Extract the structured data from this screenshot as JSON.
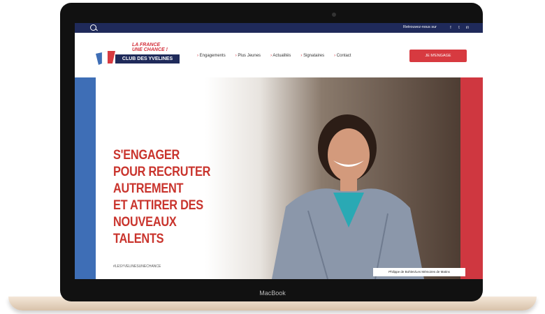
{
  "topbar": {
    "follow_text": "Retrouvez-nous sur"
  },
  "logo": {
    "line1": "LA FRANCE",
    "line2": "UNE CHANCE !",
    "club": "CLUB DES YVELINES"
  },
  "nav": {
    "items": [
      "Engagements",
      "Plus Jeunes",
      "Actualités",
      "Signataires",
      "Contact"
    ],
    "cta": "JE M'ENGAGE"
  },
  "hero": {
    "headline_lines": [
      "S'ENGAGER",
      "POUR RECRUTER AUTREMENT",
      "ET ATTIRER DES NOUVEAUX",
      "TALENTS"
    ],
    "hashtag": "#LESYVELINESUNECHANCE",
    "caption": "Philippe de Bohlen/Les Mémoires de Matins"
  },
  "device": {
    "brand": "MacBook"
  },
  "colors": {
    "navy": "#1f2a5a",
    "red": "#d73a40",
    "blue": "#3e6eb6",
    "headline": "#c9342d"
  }
}
